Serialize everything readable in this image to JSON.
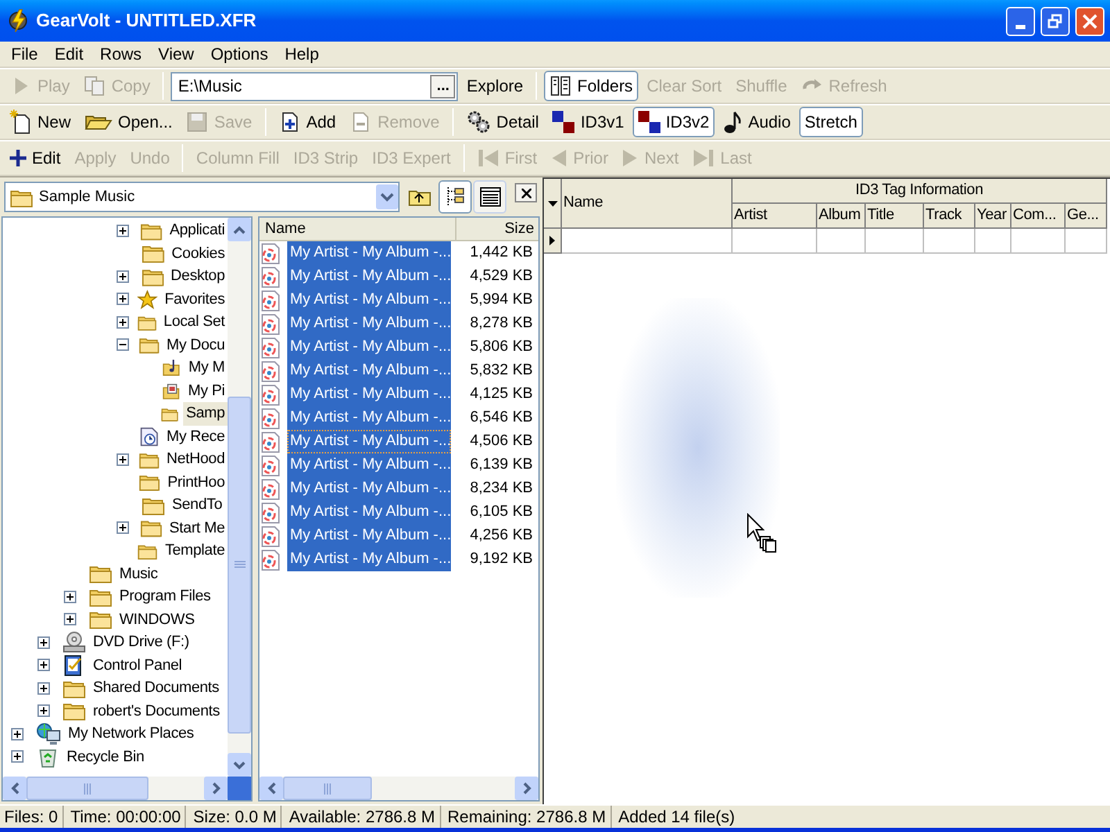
{
  "window": {
    "title": "GearVolt - UNTITLED.XFR"
  },
  "menu": [
    "File",
    "Edit",
    "Rows",
    "View",
    "Options",
    "Help"
  ],
  "toolbars": [
    {
      "items": [
        {
          "kind": "button",
          "label": "Play",
          "disabled": true,
          "selected": false
        },
        {
          "kind": "button",
          "label": "Copy",
          "disabled": true,
          "selected": false
        },
        {
          "kind": "separator"
        },
        {
          "kind": "path_field",
          "value": "E:\\Music",
          "browse_label": "..."
        },
        {
          "kind": "button",
          "label": "Explore",
          "disabled": false,
          "selected": false
        },
        {
          "kind": "separator"
        },
        {
          "kind": "button",
          "label": "Folders",
          "disabled": false,
          "selected": true
        },
        {
          "kind": "button",
          "label": "Clear Sort",
          "disabled": true,
          "selected": false
        },
        {
          "kind": "button",
          "label": "Shuffle",
          "disabled": true,
          "selected": false
        },
        {
          "kind": "button",
          "label": "Refresh",
          "disabled": true,
          "selected": false
        }
      ]
    },
    {
      "items": [
        {
          "kind": "button",
          "label": "New",
          "disabled": false,
          "selected": false
        },
        {
          "kind": "button",
          "label": "Open...",
          "disabled": false,
          "selected": false
        },
        {
          "kind": "button",
          "label": "Save",
          "disabled": true,
          "selected": false
        },
        {
          "kind": "separator"
        },
        {
          "kind": "button",
          "label": "Add",
          "disabled": false,
          "selected": false
        },
        {
          "kind": "button",
          "label": "Remove",
          "disabled": true,
          "selected": false
        },
        {
          "kind": "separator"
        },
        {
          "kind": "button",
          "label": "Detail",
          "disabled": false,
          "selected": false
        },
        {
          "kind": "button",
          "label": "ID3v1",
          "disabled": false,
          "selected": false
        },
        {
          "kind": "button",
          "label": "ID3v2",
          "disabled": false,
          "selected": true
        },
        {
          "kind": "button",
          "label": "Audio",
          "disabled": false,
          "selected": false
        },
        {
          "kind": "button",
          "label": "Stretch",
          "disabled": false,
          "selected": true
        }
      ]
    },
    {
      "items": [
        {
          "kind": "button",
          "label": "Edit",
          "disabled": false,
          "selected": false
        },
        {
          "kind": "button",
          "label": "Apply",
          "disabled": true,
          "selected": false
        },
        {
          "kind": "button",
          "label": "Undo",
          "disabled": true,
          "selected": false
        },
        {
          "kind": "separator"
        },
        {
          "kind": "button",
          "label": "Column Fill",
          "disabled": true,
          "selected": false
        },
        {
          "kind": "button",
          "label": "ID3 Strip",
          "disabled": true,
          "selected": false
        },
        {
          "kind": "button",
          "label": "ID3 Expert",
          "disabled": true,
          "selected": false
        },
        {
          "kind": "separator"
        },
        {
          "kind": "button",
          "label": "First",
          "disabled": true,
          "selected": false
        },
        {
          "kind": "button",
          "label": "Prior",
          "disabled": true,
          "selected": false
        },
        {
          "kind": "button",
          "label": "Next",
          "disabled": true,
          "selected": false
        },
        {
          "kind": "button",
          "label": "Last",
          "disabled": true,
          "selected": false
        }
      ]
    }
  ],
  "folder_combo": {
    "value": "Sample Music"
  },
  "view_buttons": [
    {
      "selected": true
    },
    {
      "selected": false
    }
  ],
  "tree": {
    "items": [
      {
        "children": [
          {
            "children": [
              {
                "children": [
                  {
                    "children": [
                      {
                        "label": "Applicati",
                        "kind": "folder",
                        "expanded": false,
                        "selected": false
                      },
                      {
                        "label": "Cookies",
                        "kind": "folder",
                        "selected": false
                      },
                      {
                        "label": "Desktop",
                        "kind": "folder",
                        "expanded": false,
                        "selected": false
                      },
                      {
                        "label": "Favorites",
                        "kind": "favorites",
                        "expanded": false,
                        "selected": false
                      },
                      {
                        "label": "Local Set",
                        "kind": "folder",
                        "expanded": false,
                        "selected": false
                      },
                      {
                        "label": "My Docu",
                        "kind": "folder",
                        "expanded": true,
                        "selected": false,
                        "children": [
                          {
                            "label": "My M",
                            "kind": "music-folder",
                            "selected": false
                          },
                          {
                            "label": "My Pi",
                            "kind": "pictures-folder",
                            "selected": false
                          },
                          {
                            "label": "Samp",
                            "kind": "folder",
                            "selected": true
                          }
                        ]
                      },
                      {
                        "label": "My Rece",
                        "kind": "recent",
                        "selected": false
                      },
                      {
                        "label": "NetHood",
                        "kind": "folder",
                        "expanded": false,
                        "selected": false
                      },
                      {
                        "label": "PrintHoo",
                        "kind": "folder",
                        "selected": false
                      },
                      {
                        "label": "SendTo",
                        "kind": "folder",
                        "selected": false
                      },
                      {
                        "label": "Start Me",
                        "kind": "folder",
                        "expanded": false,
                        "selected": false
                      },
                      {
                        "label": "Template",
                        "kind": "folder",
                        "selected": false
                      }
                    ]
                  }
                ]
              },
              {
                "label": "Music",
                "kind": "folder",
                "selected": false
              },
              {
                "label": "Program Files",
                "kind": "folder",
                "expanded": false,
                "selected": false
              },
              {
                "label": "WINDOWS",
                "kind": "folder",
                "expanded": false,
                "selected": false
              }
            ]
          },
          {
            "label": "DVD Drive (F:)",
            "kind": "drive",
            "expanded": false,
            "selected": false
          },
          {
            "label": "Control Panel",
            "kind": "control-panel",
            "expanded": false,
            "selected": false
          },
          {
            "label": "Shared Documents",
            "kind": "folder",
            "expanded": false,
            "selected": false
          },
          {
            "label": "robert's Documents",
            "kind": "folder",
            "expanded": false,
            "selected": false
          }
        ]
      },
      {
        "label": "My Network Places",
        "kind": "network",
        "expanded": false,
        "selected": false
      },
      {
        "label": "Recycle Bin",
        "kind": "recycle-bin",
        "expanded": false,
        "selected": false
      }
    ]
  },
  "file_list": {
    "columns": [
      "Name",
      "Size"
    ],
    "rows": [
      {
        "name": "My Artist - My Album -...",
        "size": "1,442 KB",
        "selected": true,
        "focused": false
      },
      {
        "name": "My Artist - My Album -...",
        "size": "4,529 KB",
        "selected": true,
        "focused": false
      },
      {
        "name": "My Artist - My Album -...",
        "size": "5,994 KB",
        "selected": true,
        "focused": false
      },
      {
        "name": "My Artist - My Album -...",
        "size": "8,278 KB",
        "selected": true,
        "focused": false
      },
      {
        "name": "My Artist - My Album -...",
        "size": "5,806 KB",
        "selected": true,
        "focused": false
      },
      {
        "name": "My Artist - My Album -...",
        "size": "5,832 KB",
        "selected": true,
        "focused": false
      },
      {
        "name": "My Artist - My Album -...",
        "size": "4,125 KB",
        "selected": true,
        "focused": false
      },
      {
        "name": "My Artist - My Album -...",
        "size": "6,546 KB",
        "selected": true,
        "focused": false
      },
      {
        "name": "My Artist - My Album -...",
        "size": "4,506 KB",
        "selected": true,
        "focused": true
      },
      {
        "name": "My Artist - My Album -...",
        "size": "6,139 KB",
        "selected": true,
        "focused": false
      },
      {
        "name": "My Artist - My Album -...",
        "size": "8,234 KB",
        "selected": true,
        "focused": false
      },
      {
        "name": "My Artist - My Album -...",
        "size": "6,105 KB",
        "selected": true,
        "focused": false
      },
      {
        "name": "My Artist - My Album -...",
        "size": "4,256 KB",
        "selected": true,
        "focused": false
      },
      {
        "name": "My Artist - My Album -...",
        "size": "9,192 KB",
        "selected": true,
        "focused": false
      }
    ]
  },
  "grid": {
    "name_column": "Name",
    "group_header": "ID3 Tag Information",
    "columns": [
      "Artist",
      "Album",
      "Title",
      "Track",
      "Year",
      "Com...",
      "Ge..."
    ]
  },
  "status_bar": [
    "Files: 0",
    "Time: 00:00:00",
    "Size: 0.0 M",
    "Available: 2786.8 M",
    "Remaining: 2786.8 M",
    "Added 14 file(s)"
  ]
}
